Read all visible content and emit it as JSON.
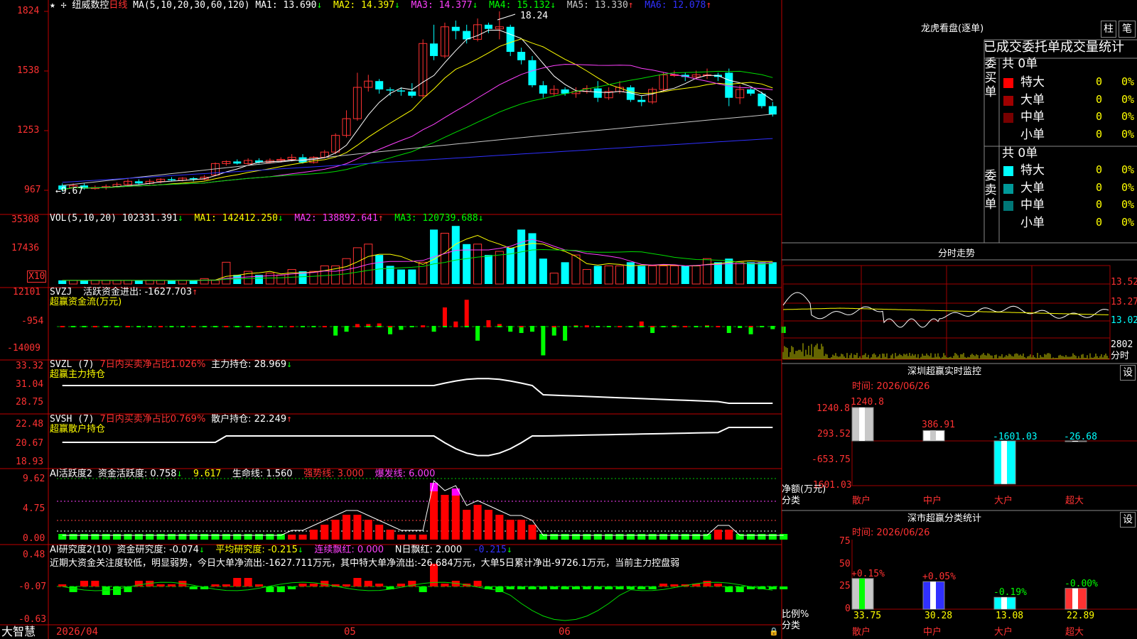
{
  "main": {
    "stock_name": "纽威数控",
    "period": "日线",
    "ma_label": "MA(5,10,20,30,60,120)",
    "ma1": "MA1: 13.690",
    "ma2": "MA2: 14.397",
    "ma3": "MA3: 14.377",
    "ma4": "MA4: 15.132",
    "ma5": "MA5: 13.330",
    "ma6": "MA6: 12.078",
    "high_mark": "18.24",
    "low_mark": "9.67",
    "y_ticks": [
      "1824",
      "1538",
      "1253",
      "967"
    ]
  },
  "vol": {
    "label": "VOL(5,10,20)",
    "value": "102331.391",
    "ma1": "MA1: 142412.250",
    "ma2": "MA2: 138892.641",
    "ma3": "MA3: 120739.688",
    "y_ticks": [
      "35308",
      "17436"
    ],
    "unit": "X10"
  },
  "svzj": {
    "label": "SVZJ",
    "text": "活跃资金进出: -1627.703",
    "sub": "超赢资金流(万元)",
    "y_ticks": [
      "12101",
      "-954",
      "-14009"
    ]
  },
  "svzl": {
    "label": "SVZL (7)",
    "text1": "7日内买卖净占比1.026%",
    "text2": "主力持仓: 28.969",
    "sub": "超赢主力持仓",
    "y_ticks": [
      "33.32",
      "31.04",
      "28.75"
    ]
  },
  "svsh": {
    "label": "SVSH (7)",
    "text1": "7日内买卖净占比0.769%",
    "text2": "散户持仓: 22.249",
    "sub": "超赢散户持仓",
    "y_ticks": [
      "22.48",
      "20.67",
      "18.93"
    ]
  },
  "ai1": {
    "label": "AI活跃度2",
    "t1": "资金活跃度: 0.758",
    "t2": "9.617",
    "t3": "生命线: 1.560",
    "t4": "强势线: 3.000",
    "t5": "爆发线: 6.000",
    "y_ticks": [
      "9.62",
      "4.75",
      "0.00"
    ]
  },
  "ai2": {
    "label": "AI研究度2(10)",
    "t1": "资金研究度: -0.074",
    "t2": "平均研究度: -0.215",
    "t3": "连续飘红: 0.000",
    "t4": "N日飘红: 2.000",
    "t5": "-0.215",
    "comment": "近期大资金关注度较低，明显弱势，今日大单净流出:-1627.711万元，其中特大单净流出:-26.684万元，大单5日累计净出-9726.1万元，当前主力控盘弱",
    "y_ticks": [
      "0.48",
      "-0.07",
      "-0.63"
    ]
  },
  "bottom": {
    "brand": "大智慧",
    "date": "2026/04",
    "m05": "05",
    "m06": "06"
  },
  "dragon": {
    "title": "龙虎看盘(逐单)",
    "btn_bar": "柱",
    "btn_pen": "笔",
    "header": "已成交委托单成交量统计",
    "buy_side": "委买单",
    "sell_side": "委卖单",
    "buy_total": "共 0单",
    "sell_total": "共 0单",
    "buy_rows": [
      {
        "name": "特大",
        "count": "0",
        "pct": "0%",
        "color": "#ff0000"
      },
      {
        "name": "大单",
        "count": "0",
        "pct": "0%",
        "color": "#a00000"
      },
      {
        "name": "中单",
        "count": "0",
        "pct": "0%",
        "color": "#780000"
      },
      {
        "name": "小单",
        "count": "0",
        "pct": "0%",
        "color": ""
      }
    ],
    "sell_rows": [
      {
        "name": "特大",
        "count": "0",
        "pct": "0%",
        "color": "#00ffff"
      },
      {
        "name": "大单",
        "count": "0",
        "pct": "0%",
        "color": "#009999"
      },
      {
        "name": "中单",
        "count": "0",
        "pct": "0%",
        "color": "#007777"
      },
      {
        "name": "小单",
        "count": "0",
        "pct": "0%",
        "color": ""
      }
    ]
  },
  "intraday": {
    "title": "分时走势",
    "y_ticks": [
      "13.52",
      "13.27",
      "13.02"
    ],
    "vol_tick": "2802",
    "vol_unit": "分时"
  },
  "sz_monitor": {
    "title": "深圳超赢实时监控",
    "btn": "设",
    "time": "时间: 2026/06/26",
    "y_ticks": [
      "1240.8",
      "293.52",
      "-653.75",
      "-1601.03"
    ],
    "y_unit": "净额(万元)",
    "x_unit": "分类",
    "cats": [
      "散户",
      "中户",
      "大户",
      "超大"
    ],
    "values": [
      1240.8,
      386.91,
      -1601.03,
      -26.68
    ],
    "value_labels": [
      "1240.8",
      "386.91",
      "-1601.03",
      "-26.68"
    ]
  },
  "sz_class": {
    "title": "深市超赢分类统计",
    "btn": "设",
    "time": "时间: 2026/06/26",
    "y_ticks": [
      "75",
      "50",
      "25",
      "0"
    ],
    "y_unit": "比例%",
    "x_unit": "分类",
    "cats": [
      "散户",
      "中户",
      "大户",
      "超大"
    ],
    "values": [
      33.75,
      30.28,
      13.08,
      22.89
    ],
    "changes": [
      "+0.15%",
      "+0.05%",
      "-0.19%",
      "-0.00%"
    ]
  }
}
